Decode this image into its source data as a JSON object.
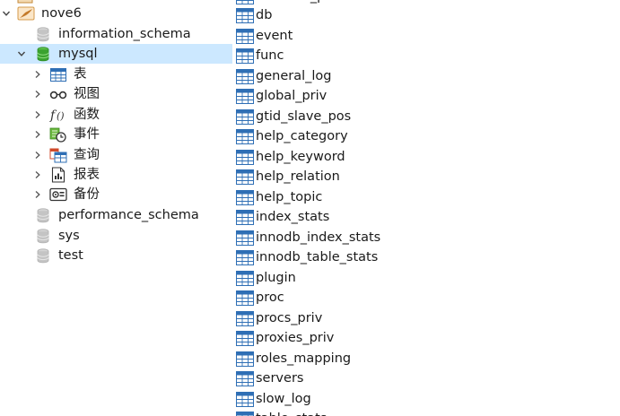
{
  "tree": {
    "connection": {
      "label": "nove6",
      "expanded": true
    },
    "databases": [
      {
        "label": "information_schema",
        "expanded": false,
        "selected": false
      },
      {
        "label": "mysql",
        "expanded": true,
        "selected": true
      },
      {
        "label": "performance_schema",
        "expanded": false,
        "selected": false
      },
      {
        "label": "sys",
        "expanded": false,
        "selected": false
      },
      {
        "label": "test",
        "expanded": false,
        "selected": false
      }
    ],
    "mysql_children": [
      {
        "label": "表",
        "icon": "table-icon"
      },
      {
        "label": "视图",
        "icon": "view-icon"
      },
      {
        "label": "函数",
        "icon": "function-icon"
      },
      {
        "label": "事件",
        "icon": "event-icon"
      },
      {
        "label": "查询",
        "icon": "query-icon"
      },
      {
        "label": "报表",
        "icon": "report-icon"
      },
      {
        "label": "备份",
        "icon": "backup-icon"
      }
    ]
  },
  "tables": {
    "partial_top": "columns_priv",
    "items": [
      "db",
      "event",
      "func",
      "general_log",
      "global_priv",
      "gtid_slave_pos",
      "help_category",
      "help_keyword",
      "help_relation",
      "help_topic",
      "index_stats",
      "innodb_index_stats",
      "innodb_table_stats",
      "plugin",
      "proc",
      "procs_priv",
      "proxies_priv",
      "roles_mapping",
      "servers",
      "slow_log"
    ],
    "partial_bottom": "table_stats"
  },
  "colors": {
    "selection": "#cce8ff",
    "db_active": "#3aa22f",
    "db_inactive": "#b8b8b8",
    "table_icon_blue": "#2f6fb5",
    "connection_orange": "#e08a1e"
  }
}
